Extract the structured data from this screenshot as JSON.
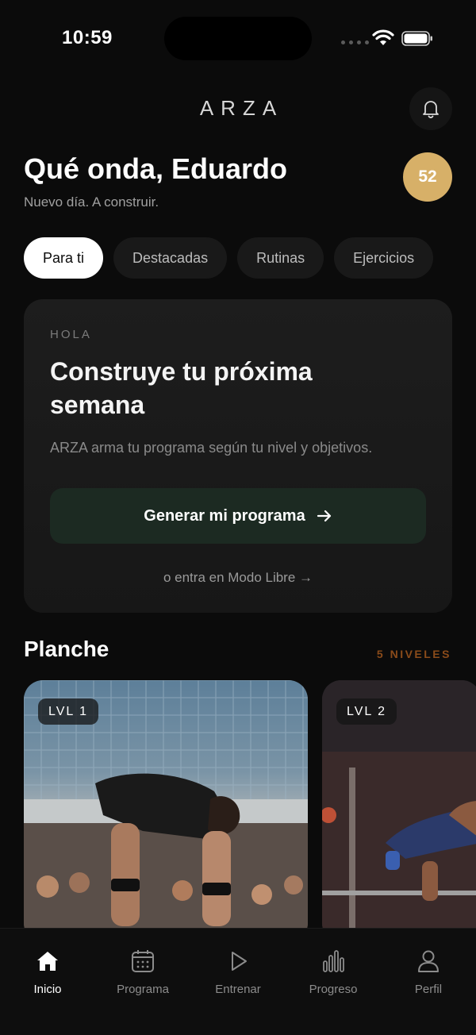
{
  "status_bar": {
    "time": "10:59"
  },
  "header": {
    "brand": "ARZA",
    "notification_icon": "bell-icon"
  },
  "greeting": {
    "title": "Qué onda, Eduardo",
    "subtitle": "Nuevo día. A construir.",
    "streak_count": "52",
    "streak_color": "#d7b068"
  },
  "tabs": [
    {
      "label": "Para ti",
      "active": true
    },
    {
      "label": "Destacadas",
      "active": false
    },
    {
      "label": "Rutinas",
      "active": false
    },
    {
      "label": "Ejercicios",
      "active": false
    }
  ],
  "hero": {
    "eyebrow": "HOLA",
    "title": "Construye tu próxima semana",
    "description": "ARZA arma tu programa según tu nivel y objetivos.",
    "cta_label": "Generar mi programa",
    "cta_icon": "arrow-right-icon",
    "free_mode_link": "o entra en Modo Libre →"
  },
  "section": {
    "title": "Planche",
    "meta": "5 NIVELES",
    "meta_color": "#8a4b1a",
    "cards": [
      {
        "badge": "LVL 1"
      },
      {
        "badge": "LVL 2"
      }
    ]
  },
  "bottom_nav": [
    {
      "label": "Inicio",
      "icon": "home-icon",
      "active": true
    },
    {
      "label": "Programa",
      "icon": "calendar-icon",
      "active": false
    },
    {
      "label": "Entrenar",
      "icon": "play-icon",
      "active": false
    },
    {
      "label": "Progreso",
      "icon": "bar-chart-icon",
      "active": false
    },
    {
      "label": "Perfil",
      "icon": "user-icon",
      "active": false
    }
  ]
}
